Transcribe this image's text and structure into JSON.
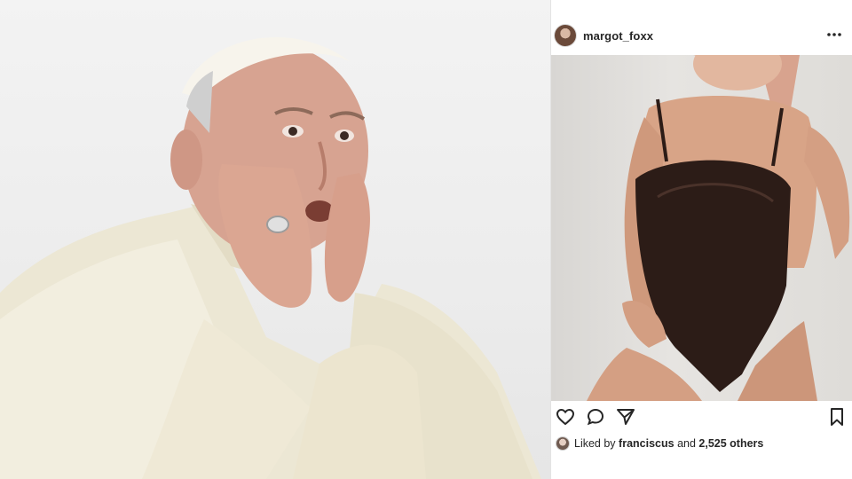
{
  "post": {
    "username": "margot_foxx",
    "more_icon": "more-horizontal-icon",
    "actions": {
      "like_icon": "heart-icon",
      "comment_icon": "comment-icon",
      "share_icon": "send-icon",
      "save_icon": "bookmark-icon"
    },
    "likes": {
      "prefix": "Liked by",
      "user": "franciscus",
      "conjunction": "and",
      "others": "2,525 others"
    }
  },
  "colors": {
    "text": "#262626",
    "background": "#ffffff",
    "divider": "#e3e3e3"
  }
}
